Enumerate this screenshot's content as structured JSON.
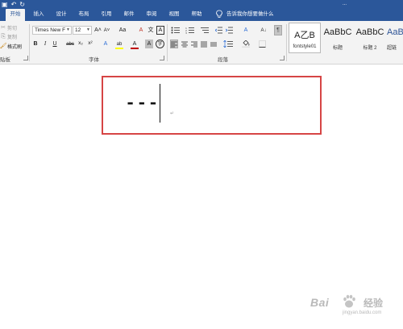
{
  "title_bar": {
    "text": "..."
  },
  "tabs": [
    {
      "label": "开始",
      "active": true
    },
    {
      "label": "插入"
    },
    {
      "label": "设计"
    },
    {
      "label": "布局"
    },
    {
      "label": "引用"
    },
    {
      "label": "邮件"
    },
    {
      "label": "审阅"
    },
    {
      "label": "视图"
    },
    {
      "label": "帮助"
    }
  ],
  "tell_me": "告诉我你想要做什么",
  "clipboard": {
    "cut": "剪切",
    "copy": "复制",
    "format_painter": "格式刷",
    "group_label": "贴板"
  },
  "font": {
    "name": "Times New F",
    "size": "12",
    "group_label": "字体",
    "grow": "A˄",
    "shrink": "A˅",
    "case": "Aa",
    "clear": "A",
    "phonetic": "文",
    "border": "A",
    "bold": "B",
    "italic": "I",
    "underline": "U",
    "strike": "abc",
    "subscript": "x₂",
    "superscript": "x²",
    "effects": "A",
    "highlight": "ab",
    "color": "A",
    "shading": "A",
    "enclose": "字"
  },
  "paragraph": {
    "group_label": "段落",
    "chinese_layout": "A",
    "sort": "A↓",
    "show_marks": "¶"
  },
  "styles": [
    {
      "preview": "A乙B",
      "name": "fontstyle01",
      "selected": true
    },
    {
      "preview": "AaBbC",
      "name": "标题"
    },
    {
      "preview": "AaBbC",
      "name": "标题 2"
    },
    {
      "preview": "AaBbC",
      "name": "超链"
    }
  ],
  "document": {
    "content": "---",
    "paragraph_mark": "↵"
  },
  "watermark": {
    "logo": "Bai",
    "cn": "经验",
    "url": "jingyan.baidu.com"
  },
  "colors": {
    "brand": "#2b579a",
    "ribbon_bg": "#f3f3f3",
    "highlight_border": "#d64545",
    "font_color_bar": "#c00000",
    "highlight_bar": "#ffff00"
  }
}
